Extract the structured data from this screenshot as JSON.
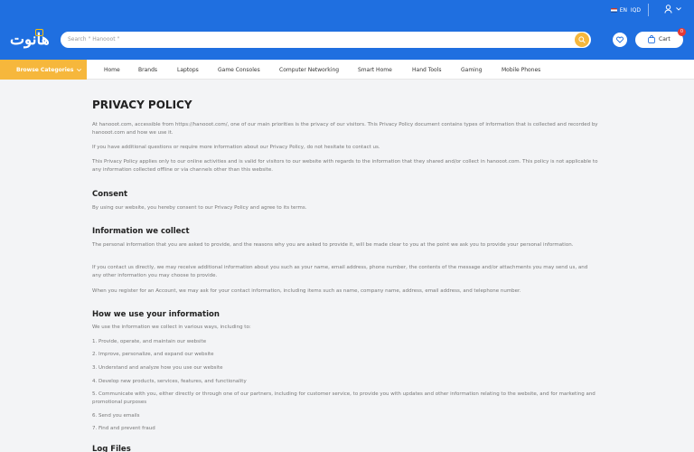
{
  "topbar": {
    "language": "EN",
    "currency": "IQD"
  },
  "header": {
    "logo_text": "هانوت",
    "search_placeholder": "Search \" Hanooot \"",
    "cart_label": "Cart",
    "cart_count": "0"
  },
  "nav": {
    "browse_label": "Browse Categories",
    "items": [
      "Home",
      "Brands",
      "Laptops",
      "Game Consoles",
      "Computer Networking",
      "Smart Home",
      "Hand Tools",
      "Gaming",
      "Mobile Phones"
    ]
  },
  "policy": {
    "title": "PRIVACY POLICY",
    "intro": [
      "At hanooot.com, accessible from https://hanooot.com/, one of our main priorities is the privacy of our visitors. This Privacy Policy document contains types of information that is collected and recorded by hanooot.com and how we use it.",
      "If you have additional questions or require more information about our Privacy Policy, do not hesitate to contact us.",
      "This Privacy Policy applies only to our online activities and is valid for visitors to our website with regards to the information that they shared and/or collect in hanooot.com. This policy is not applicable to any information collected offline or via channels other than this website."
    ],
    "consent_heading": "Consent",
    "consent_text": "By using our website, you hereby consent to our Privacy Policy and agree to its terms.",
    "collect_heading": "Information we collect",
    "collect": [
      "The personal information that you are asked to provide, and the reasons why you are asked to provide it, will be made clear to you at the point we ask you to provide your personal information.",
      "If you contact us directly, we may receive additional information about you such as your name, email address, phone number, the contents of the message and/or attachments you may send us, and any other information you may choose to provide.",
      "When you register for an Account, we may ask for your contact information, including items such as name, company name, address, email address, and telephone number."
    ],
    "use_heading": "How we use your information",
    "use_intro": "We use the information we collect in various ways, including to:",
    "use_list": [
      "1. Provide, operate, and maintain our website",
      "2. Improve, personalize, and expand our website",
      "3. Understand and analyze how you use our website",
      "4. Develop new products, services, features, and functionality",
      "5. Communicate with you, either directly or through one of our partners, including for customer service, to provide you with updates and other information relating to the website, and for marketing and promotional purposes",
      "6. Send you emails",
      "7. Find and prevent fraud"
    ],
    "logs_heading": "Log Files"
  }
}
